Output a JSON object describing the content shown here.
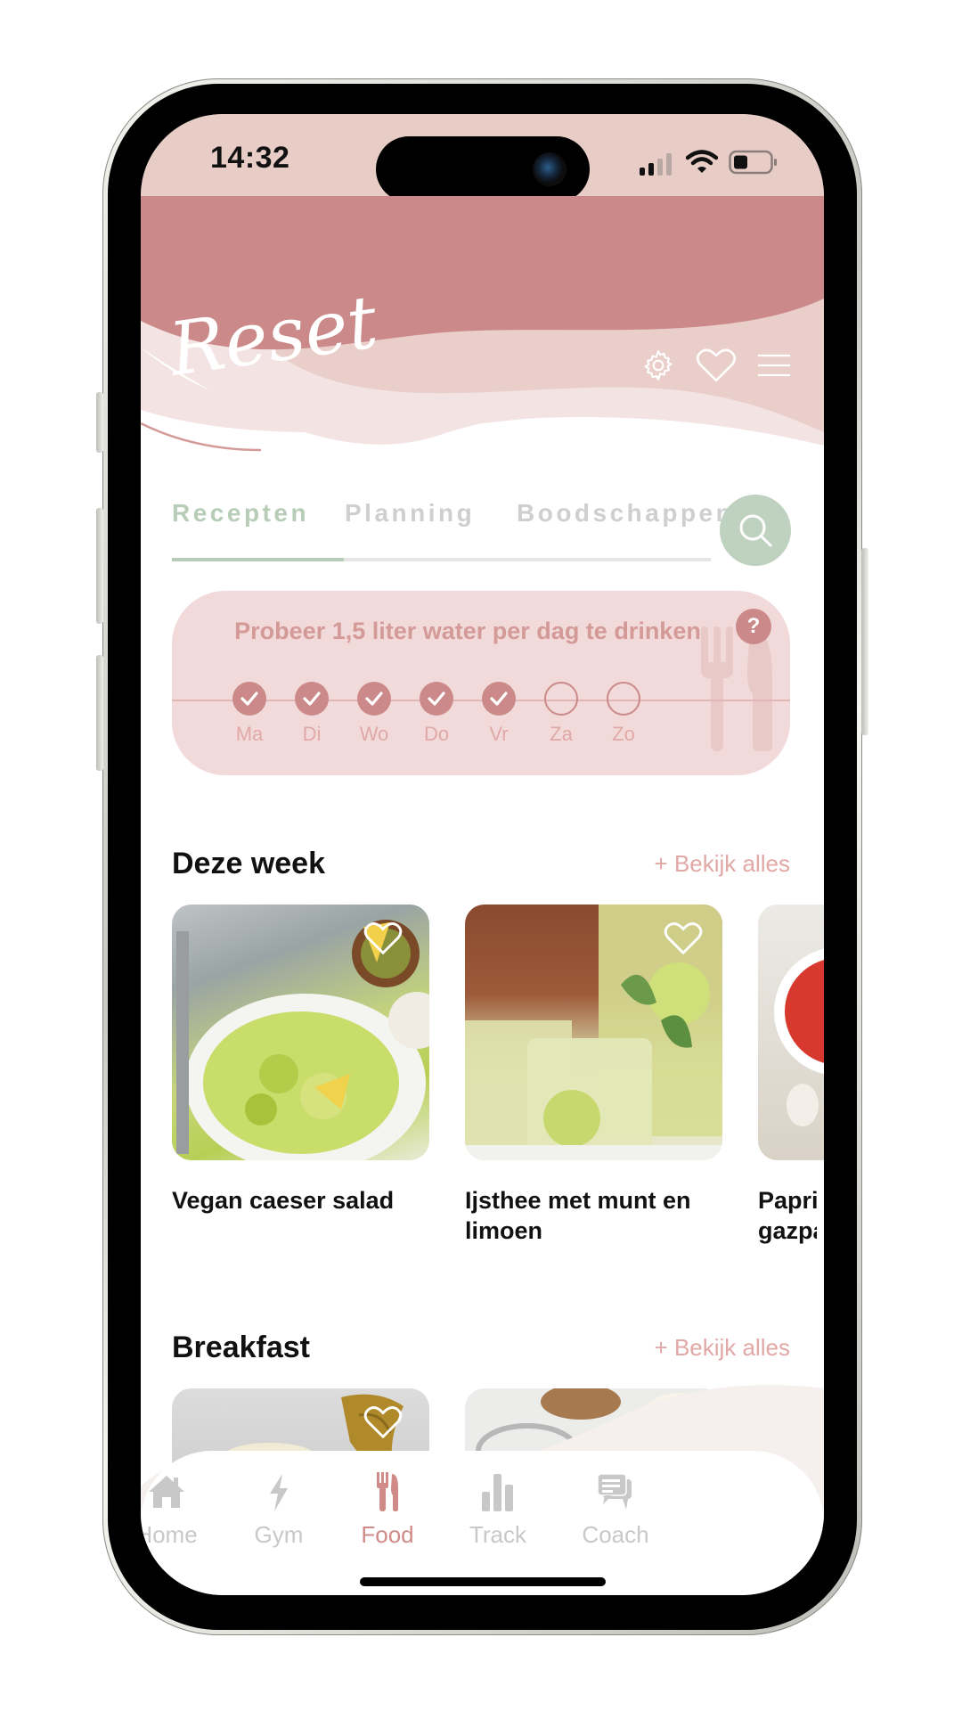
{
  "status_bar": {
    "time": "14:32",
    "signal_bars_active": 2,
    "signal_bars_total": 4,
    "battery_percent": 30
  },
  "header": {
    "logo": "Reset",
    "icons": [
      "gear-icon",
      "heart-icon",
      "menu-icon"
    ],
    "colors": {
      "primary": "#cb8a89",
      "status_bg": "#e8cdc7"
    }
  },
  "tabs": {
    "items": [
      {
        "label": "Recepten",
        "active": true
      },
      {
        "label": "Planning",
        "active": false
      },
      {
        "label": "Boodschappen",
        "active": false
      }
    ],
    "active_color": "#b7cdb8",
    "search_icon": "search-icon"
  },
  "water_tracker": {
    "title": "Probeer 1,5 liter water per dag te drinken",
    "help_label": "?",
    "days": [
      {
        "label": "Ma",
        "done": true
      },
      {
        "label": "Di",
        "done": true
      },
      {
        "label": "Wo",
        "done": true
      },
      {
        "label": "Do",
        "done": true
      },
      {
        "label": "Vr",
        "done": true
      },
      {
        "label": "Za",
        "done": false
      },
      {
        "label": "Zo",
        "done": false
      }
    ]
  },
  "sections": [
    {
      "title": "Deze week",
      "see_all": "+ Bekijk alles",
      "recipes": [
        {
          "title": "Vegan caeser salad",
          "image": "salad-photo"
        },
        {
          "title": "Ijsthee met munt en limoen",
          "image": "iced-tea-photo"
        },
        {
          "title": "Paprika gazpacho",
          "visible_title": "Papril gon",
          "image": "soup-photo"
        }
      ]
    },
    {
      "title": "Breakfast",
      "see_all": "+ Bekijk alles",
      "recipes": [
        {
          "title": "",
          "image": "breakfast-photo-1"
        },
        {
          "title": "",
          "image": "granola-jars-photo"
        }
      ]
    }
  ],
  "bottom_nav": {
    "items": [
      {
        "label": "Home",
        "icon": "home-icon",
        "active": false
      },
      {
        "label": "Gym",
        "icon": "lightning-icon",
        "active": false
      },
      {
        "label": "Food",
        "icon": "cutlery-icon",
        "active": true
      },
      {
        "label": "Track",
        "icon": "bar-chart-icon",
        "active": false
      },
      {
        "label": "Coach",
        "icon": "chat-icon",
        "active": false
      }
    ]
  }
}
